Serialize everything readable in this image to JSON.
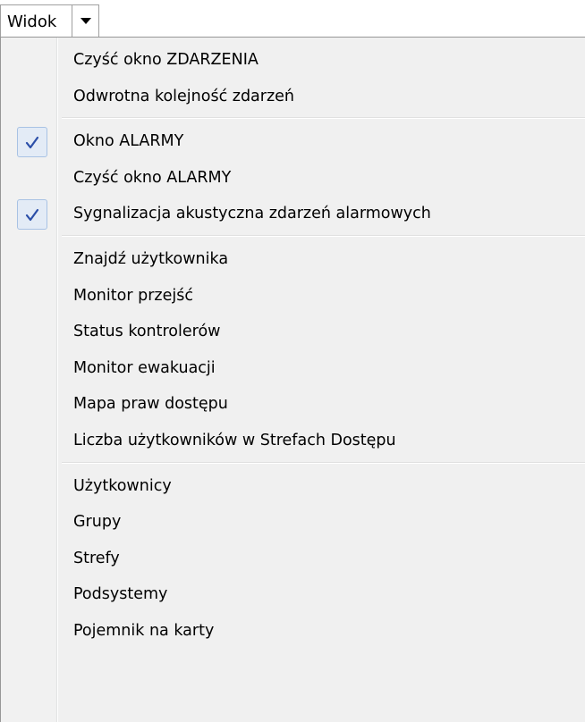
{
  "menu_title": {
    "label": "Widok",
    "dropdown_icon": "chevron-down-icon"
  },
  "menu": {
    "groups": [
      {
        "items": [
          {
            "label": "Czyść okno ZDARZENIA",
            "checked": false
          },
          {
            "label": "Odwrotna kolejność zdarzeń",
            "checked": false
          }
        ]
      },
      {
        "items": [
          {
            "label": "Okno ALARMY",
            "checked": true
          },
          {
            "label": "Czyść okno ALARMY",
            "checked": false
          },
          {
            "label": "Sygnalizacja akustyczna zdarzeń alarmowych",
            "checked": true
          }
        ]
      },
      {
        "items": [
          {
            "label": "Znajdź użytkownika",
            "checked": false
          },
          {
            "label": "Monitor przejść",
            "checked": false
          },
          {
            "label": "Status kontrolerów",
            "checked": false
          },
          {
            "label": "Monitor ewakuacji",
            "checked": false
          },
          {
            "label": "Mapa praw dostępu",
            "checked": false
          },
          {
            "label": "Liczba użytkowników w Strefach Dostępu",
            "checked": false
          }
        ]
      },
      {
        "items": [
          {
            "label": "Użytkownicy",
            "checked": false
          },
          {
            "label": "Grupy",
            "checked": false
          },
          {
            "label": "Strefy",
            "checked": false
          },
          {
            "label": "Podsystemy",
            "checked": false
          },
          {
            "label": "Pojemnik na karty",
            "checked": false
          }
        ]
      }
    ]
  },
  "colors": {
    "check_mark": "#2b4ea8",
    "check_bg": "#e3ebf6",
    "check_border": "#a8c2e4",
    "menu_bg": "#f0f0f0"
  }
}
